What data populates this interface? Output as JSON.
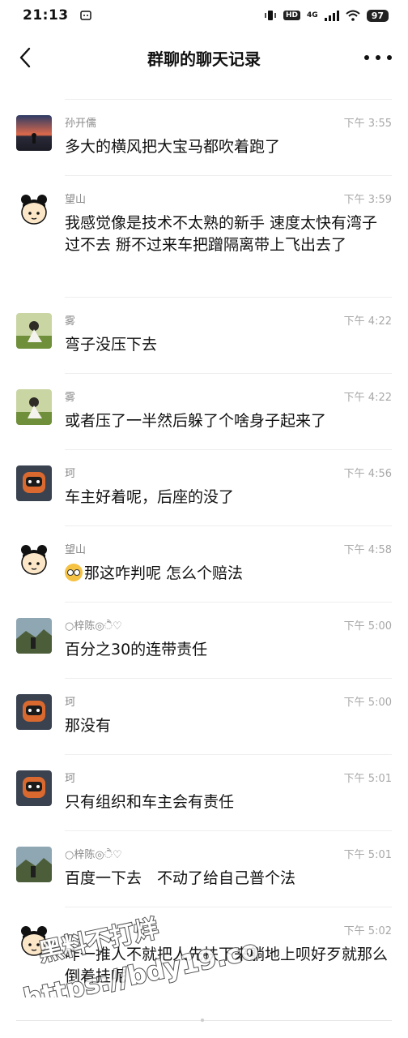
{
  "status_bar": {
    "time": "21:13",
    "hd": "HD",
    "network": "4G",
    "battery": "97",
    "notification_icon": "message-icon"
  },
  "header": {
    "title": "群聊的聊天记录",
    "back_icon": "chevron-left-icon",
    "more_icon": "more-dots-icon"
  },
  "messages": [
    {
      "sender": "孙开儒",
      "time": "下午 3:55",
      "text": "多大的横风把大宝马都吹着跑了",
      "avatar": "sunset-avatar"
    },
    {
      "sender": "望山",
      "time": "下午 3:59",
      "text": "我感觉像是技术不太熟的新手 速度太快有湾子过不去 掰不过来车把蹭隔离带上飞出去了",
      "avatar": "cartoon-avatar"
    },
    {
      "sender": "雾",
      "time": "下午 4:22",
      "text": "弯子没压下去",
      "avatar": "girl-field-avatar"
    },
    {
      "sender": "雾",
      "time": "下午 4:22",
      "text": "或者压了一半然后躲了个啥身子起来了",
      "avatar": "girl-field-avatar"
    },
    {
      "sender": "珂",
      "time": "下午 4:56",
      "text": "车主好着呢，后座的没了",
      "avatar": "robot-avatar"
    },
    {
      "sender": "望山",
      "time": "下午 4:58",
      "text": "那这咋判呢 怎么个赔法",
      "avatar": "cartoon-avatar",
      "emoji": "flushed-face-emoji"
    },
    {
      "sender": "○梓陈◎ੈ♡",
      "time": "下午 5:00",
      "text": "百分之30的连带责任",
      "avatar": "landscape-avatar"
    },
    {
      "sender": "珂",
      "time": "下午 5:00",
      "text": "那没有",
      "avatar": "robot-avatar"
    },
    {
      "sender": "珂",
      "time": "下午 5:01",
      "text": "只有组织和车主会有责任",
      "avatar": "robot-avatar"
    },
    {
      "sender": "○梓陈◎ੈ♡",
      "time": "下午 5:01",
      "text": "百度一下去　不动了给自己普个法",
      "avatar": "landscape-avatar"
    },
    {
      "sender": "",
      "time": "下午 5:02",
      "text": "咋一推人不就把人先扶下来躺地上呗好歹就那么倒着挂呢",
      "avatar": "cartoon-avatar"
    }
  ],
  "watermark": {
    "line1": "黑料不打烊",
    "line2": "https://bdy19.co"
  }
}
